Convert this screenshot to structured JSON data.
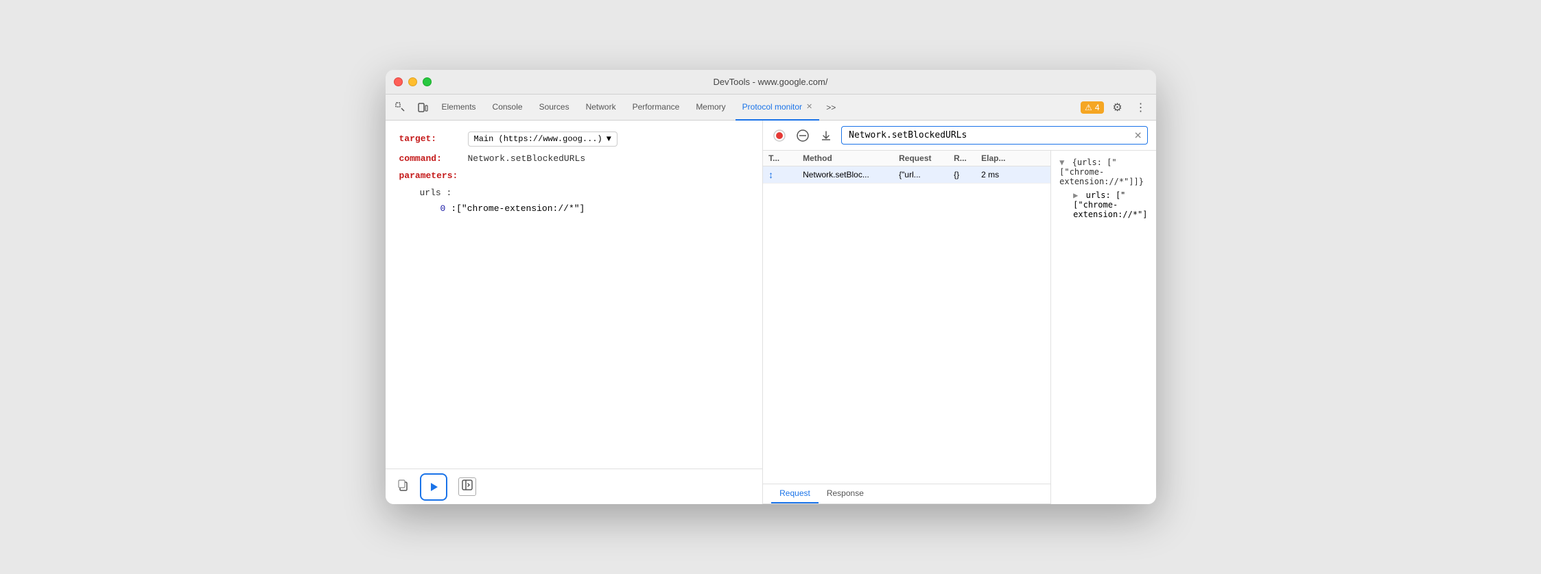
{
  "window": {
    "title": "DevTools - www.google.com/"
  },
  "toolbar": {
    "tabs": [
      {
        "id": "elements",
        "label": "Elements",
        "active": false
      },
      {
        "id": "console",
        "label": "Console",
        "active": false
      },
      {
        "id": "sources",
        "label": "Sources",
        "active": false
      },
      {
        "id": "network",
        "label": "Network",
        "active": false
      },
      {
        "id": "performance",
        "label": "Performance",
        "active": false
      },
      {
        "id": "memory",
        "label": "Memory",
        "active": false
      },
      {
        "id": "protocol-monitor",
        "label": "Protocol monitor",
        "active": true
      }
    ],
    "more_tabs": ">>",
    "badge_count": "4",
    "settings_icon": "⚙",
    "more_icon": "⋮"
  },
  "left_panel": {
    "target_label": "target:",
    "target_value": "Main (https://www.goog...)",
    "command_label": "command:",
    "command_value": "Network.setBlockedURLs",
    "parameters_label": "parameters:",
    "urls_label": "urls :",
    "index_label": "0",
    "index_value": ":[\"chrome-extension://*\"]"
  },
  "right_panel": {
    "stop_icon": "⏹",
    "clear_icon": "⊘",
    "download_icon": "⬇",
    "search_value": "Network.setBlockedURLs",
    "clear_search_icon": "✕",
    "sub_tabs": [
      {
        "label": "Request",
        "active": true
      },
      {
        "label": "Response",
        "active": false
      }
    ],
    "table_headers": [
      {
        "id": "t",
        "label": "T..."
      },
      {
        "id": "method",
        "label": "Method"
      },
      {
        "id": "request",
        "label": "Request"
      },
      {
        "id": "r",
        "label": "R..."
      },
      {
        "id": "elapsed",
        "label": "Elap..."
      }
    ],
    "table_rows": [
      {
        "icon": "↕",
        "method": "Network.setBloc...",
        "request": "{\"url...",
        "r": "{}",
        "elapsed": "2 ms"
      }
    ],
    "detail": {
      "line1": "▼ {urls: [\"[\"chrome-extension://*\"]]}",
      "line2": "▶ urls: [\"[\"chrome-extension://*\"]"
    }
  },
  "footer": {
    "copy_icon": "copy",
    "play_icon": "play",
    "collapse_icon": "collapse"
  }
}
